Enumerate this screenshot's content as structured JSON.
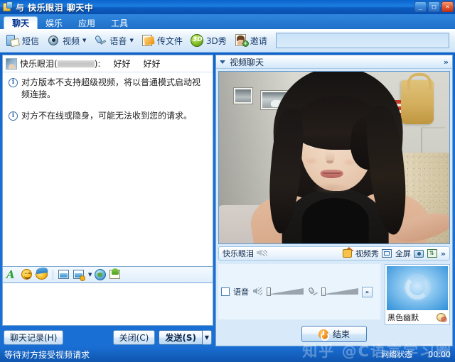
{
  "window": {
    "title": "与 快乐眼泪 聊天中",
    "icon": "chat-window-icon",
    "controls": {
      "minimize": "_",
      "maximize": "□",
      "close": "✕"
    }
  },
  "tabs": [
    {
      "label": "聊天",
      "active": true,
      "name": "tab-chat"
    },
    {
      "label": "娱乐",
      "active": false,
      "name": "tab-entertainment"
    },
    {
      "label": "应用",
      "active": false,
      "name": "tab-apps"
    },
    {
      "label": "工具",
      "active": false,
      "name": "tab-tools"
    }
  ],
  "toolbar": {
    "items": [
      {
        "label": "短信",
        "icon": "sms-icon",
        "has_arrow": false
      },
      {
        "label": "视频",
        "icon": "webcam-icon",
        "has_arrow": true
      },
      {
        "label": "语音",
        "icon": "microphone-icon",
        "has_arrow": true
      },
      {
        "label": "传文件",
        "icon": "send-file-icon",
        "has_arrow": false
      },
      {
        "label": "3D秀",
        "icon": "3d-show-icon",
        "has_arrow": false
      },
      {
        "label": "邀请",
        "icon": "invite-icon",
        "has_arrow": false
      }
    ],
    "arrow_glyph": "▼",
    "search_value": "",
    "search_placeholder": ""
  },
  "chat": {
    "header": {
      "nickname": "快乐眼泪",
      "uin_redacted": true,
      "separator": "(",
      "separator_end": "):",
      "message": "好好",
      "message2": "好好"
    },
    "system_messages": [
      {
        "icon": "info-icon",
        "text": "对方版本不支持超级视频，将以普通模式启动视频连接。"
      },
      {
        "icon": "info-icon",
        "text": "对方不在线或隐身，可能无法收到您的请求。"
      }
    ],
    "format_toolbar": [
      {
        "icon": "font-style-icon",
        "name": "font-style-button"
      },
      {
        "icon": "emoticon-icon",
        "name": "emoticon-button"
      },
      {
        "icon": "magic-emoticon-icon",
        "name": "magic-emoticon-button"
      },
      {
        "icon": "screenshot-icon",
        "name": "screenshot-button"
      },
      {
        "icon": "image-icon",
        "name": "image-button"
      },
      {
        "icon": "shake-icon",
        "name": "shake-button"
      },
      {
        "icon": "gift-icon",
        "name": "gift-button"
      }
    ],
    "input_value": "",
    "buttons": {
      "history": "聊天记录(H)",
      "close": "关闭(C)",
      "send": "发送(S)",
      "send_arrow": "▼"
    }
  },
  "video": {
    "panel_title": "视频聊天",
    "collapse_glyph": "▼",
    "expand_glyph": "»",
    "control_bar": {
      "peer_name": "快乐眼泪",
      "mute_icon": "speaker-mute-icon",
      "video_show": "视频秀",
      "video_show_icon": "video-show-icon",
      "fullscreen": "全屏",
      "fullscreen_icon": "fullscreen-icon",
      "snapshot_icon": "snapshot-icon",
      "swap_icon": "swap-view-icon",
      "more_glyph": "»"
    },
    "audio": {
      "voice_label": "语音",
      "voice_checked": false,
      "speaker_icon": "speaker-muted-icon",
      "microphone_icon": "microphone-icon",
      "speaker_level": 0,
      "mic_level": 0,
      "more_glyph": "»"
    },
    "selfview": {
      "name": "黑色幽默",
      "status_icon": "camera-disabled-icon"
    },
    "end_button": {
      "label": "结束",
      "icon": "power-icon"
    }
  },
  "statusbar": {
    "left_text": "等待对方接受视频请求",
    "network_label": "网络状态",
    "timer": "00:00",
    "watermark": "知乎 @C语言学习圈"
  }
}
